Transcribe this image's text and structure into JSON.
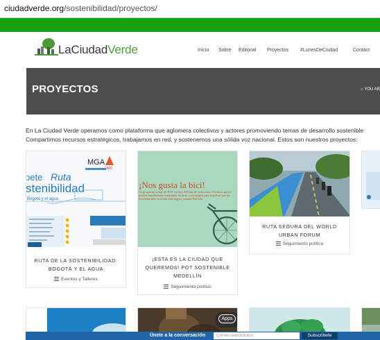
{
  "browser": {
    "url_host": "ciudadverde.org",
    "url_path": "/sostenibilidad/proyectos/"
  },
  "brand": {
    "name_prefix": "LaCiudad",
    "name_suffix": "Verde",
    "accent_green": "#14a30f"
  },
  "nav": {
    "items": [
      "Inicio",
      "Sobre",
      "Editorial",
      "Proyectos",
      "#LunesDeCiudad",
      "Contáct"
    ]
  },
  "page": {
    "title": "PROYECTOS",
    "breadcrumb": "YOU AR",
    "intro_line1": "En La Ciudad Verde operamos como plataforma que aglomera colectivos y actores promoviendo temas de desarrollo sostenible",
    "intro_line2": "Compartimos recursos estratégicos, trabajamos en red, y sostenemos una sólida voz nacional. Estos son nuestros proyectos:"
  },
  "cards": [
    {
      "title_l1": "RUTA DE LA SOSTENIBILIDAD:",
      "title_l2": "BOGOTÁ Y EL AGUA",
      "category": "Eventos y Talleres",
      "thumb": {
        "mga": "MGA",
        "year": "2400",
        "heading_a": "pete",
        "heading_b": "Ruta",
        "heading_c": "stenibilidad",
        "heading_d": "Bogotá y el agua"
      }
    },
    {
      "title_l1": "¡ESTA ES LA CIUDAD QUE",
      "title_l2": "QUEREMOS! POT SOSTENIBLE",
      "title_l3": "MEDELLÍN",
      "category": "Seguimiento político",
      "thumb": {
        "headline": "¡Nos gusta la bici!",
        "body": "La propuesta actual del POT incluye 400 km de ciclorrutas. Creemos que es posible implementar estrategias de bicis y estrategias para impulsar que las bicicletas sean la forma más segura, usando EnCicla."
      }
    },
    {
      "title_l1": "RUTA SEGURA DEL WORLD",
      "title_l2": "URBAN FORUM",
      "category": "Seguimiento político"
    }
  ],
  "footer_bar": {
    "label": "Únete a la conversación",
    "email_placeholder": "Correo electrónico",
    "subscribe": "Subscríbete",
    "apps_label": "Apps"
  }
}
